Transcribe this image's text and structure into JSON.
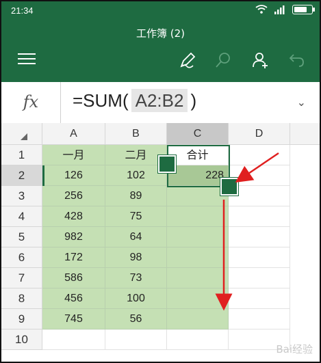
{
  "status": {
    "time": "21:34"
  },
  "app": {
    "title": "工作簿 (2)"
  },
  "toolbar": {
    "menu_icon": "hamburger-menu-icon",
    "pen_icon": "pen-edit-icon",
    "search_icon": "search-icon",
    "share_icon": "add-person-icon",
    "undo_icon": "undo-icon"
  },
  "formula_bar": {
    "fx": "fx",
    "prefix": "=SUM(",
    "reference": "A2:B2",
    "suffix": ")",
    "expand_icon": "chevron-down-icon"
  },
  "sheet": {
    "columns": [
      "A",
      "B",
      "C",
      "D"
    ],
    "rows": [
      "1",
      "2",
      "3",
      "4",
      "5",
      "6",
      "7",
      "8",
      "9",
      "10"
    ],
    "header_row": [
      "一月",
      "二月",
      "合计"
    ],
    "data": [
      [
        "126",
        "102",
        "228"
      ],
      [
        "256",
        "89",
        ""
      ],
      [
        "428",
        "75",
        ""
      ],
      [
        "982",
        "64",
        ""
      ],
      [
        "172",
        "98",
        ""
      ],
      [
        "586",
        "73",
        ""
      ],
      [
        "456",
        "100",
        ""
      ],
      [
        "745",
        "56",
        ""
      ]
    ]
  },
  "colors": {
    "accent": "#1e6b41",
    "selection_fill": "#c5e0b4",
    "arrow": "#e02020"
  },
  "watermark": "Bai经验"
}
